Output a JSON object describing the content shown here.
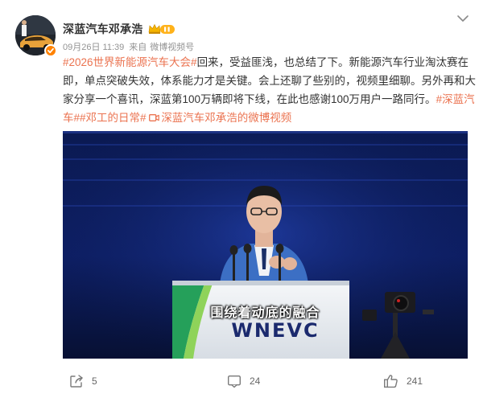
{
  "post": {
    "author": "深蓝汽车邓承浩",
    "timestamp": "09月26日 11:39",
    "source_prefix": "来自",
    "source": "微博视频号",
    "text": {
      "tag1": "#2026世界新能源汽车大会#",
      "line1_rest": "回来，受益匪浅，也总结了下。新能源汽车行业淘汰赛在",
      "line2": "即，单点突破失效，体系能力才是关键。会上还聊了些别的，视频里细聊。另外再和大",
      "line3_main": "家分享一个喜讯，深蓝第100万辆即将下线，在此也感谢100万用户一路同行。",
      "tag2_part1": "#深蓝汽",
      "tag2_part2": "车#",
      "tag3": "#邓工的日常#",
      "video_link": "深蓝汽车邓承浩的微博视频"
    }
  },
  "video": {
    "caption": "围绕着动底的融合",
    "podium_logo": "WNEVC"
  },
  "actions": {
    "share_count": "5",
    "comment_count": "24",
    "like_count": "241"
  },
  "colors": {
    "link": "#eb7350",
    "meta": "#939393",
    "verified": "#ff8200"
  }
}
